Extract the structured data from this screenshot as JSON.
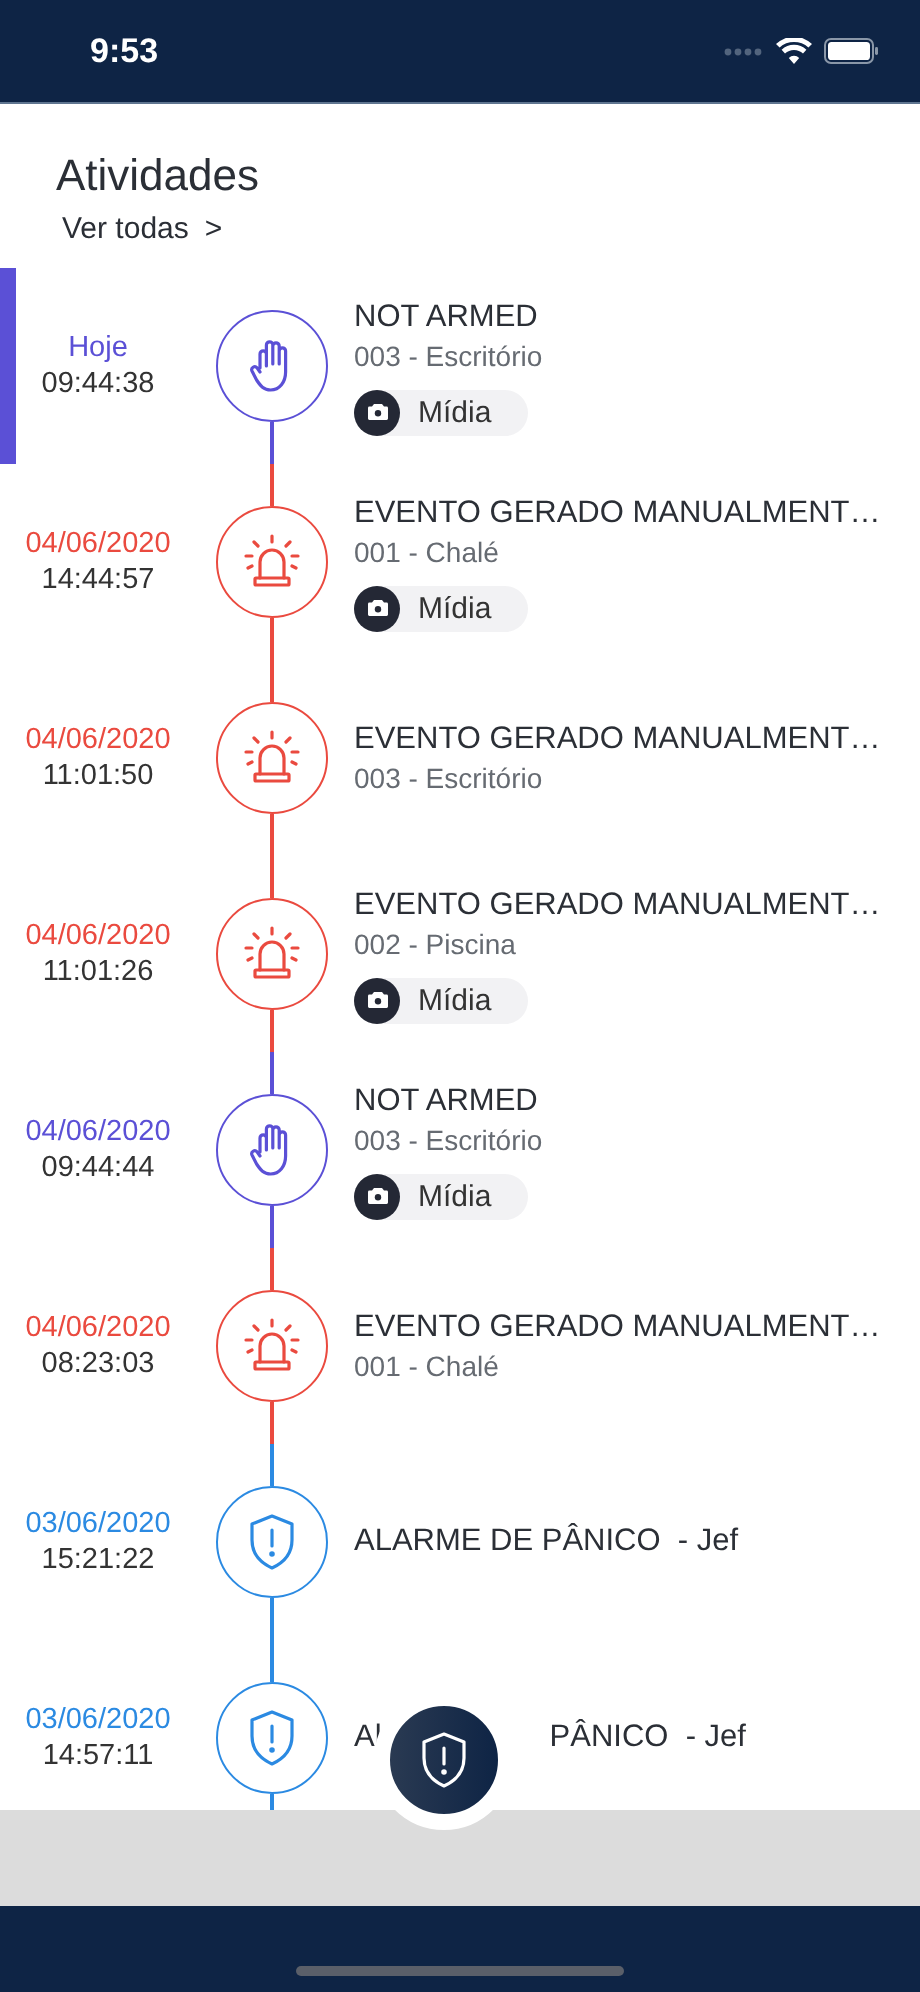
{
  "status_bar": {
    "time": "9:53"
  },
  "header": {
    "title": "Atividades",
    "link": "Ver todas",
    "link_icon": ">"
  },
  "activities": [
    {
      "kind": "hand",
      "color": "#5b50d6",
      "selected": true,
      "date": "Hoje",
      "time": "09:44:38",
      "title": "NOT ARMED",
      "subtitle": "003 - Escritório",
      "media": "Mídia"
    },
    {
      "kind": "siren",
      "color": "#ea4a3f",
      "selected": false,
      "date": "04/06/2020",
      "time": "14:44:57",
      "title": "EVENTO GERADO MANUALMENT…",
      "subtitle": "001 - Chalé",
      "media": "Mídia"
    },
    {
      "kind": "siren",
      "color": "#ea4a3f",
      "selected": false,
      "date": "04/06/2020",
      "time": "11:01:50",
      "title": "EVENTO GERADO MANUALMENT…",
      "subtitle": "003 - Escritório"
    },
    {
      "kind": "siren",
      "color": "#ea4a3f",
      "selected": false,
      "date": "04/06/2020",
      "time": "11:01:26",
      "title": "EVENTO GERADO MANUALMENT…",
      "subtitle": "002 - Piscina",
      "media": "Mídia"
    },
    {
      "kind": "hand",
      "color": "#5b50d6",
      "selected": false,
      "date": "04/06/2020",
      "time": "09:44:44",
      "title": "NOT ARMED",
      "subtitle": "003 - Escritório",
      "media": "Mídia"
    },
    {
      "kind": "siren",
      "color": "#ea4a3f",
      "selected": false,
      "date": "04/06/2020",
      "time": "08:23:03",
      "title": "EVENTO GERADO MANUALMENT…",
      "subtitle": "001 - Chalé"
    },
    {
      "kind": "shield",
      "color": "#2b8ae2",
      "selected": false,
      "date": "03/06/2020",
      "time": "15:21:22",
      "title": "ALARME DE PÂNICO  - Jef"
    },
    {
      "kind": "shield",
      "color": "#2b8ae2",
      "selected": false,
      "date": "03/06/2020",
      "time": "14:57:11",
      "title_parts": [
        "Al",
        "PÂNICO  - Jef"
      ]
    }
  ]
}
